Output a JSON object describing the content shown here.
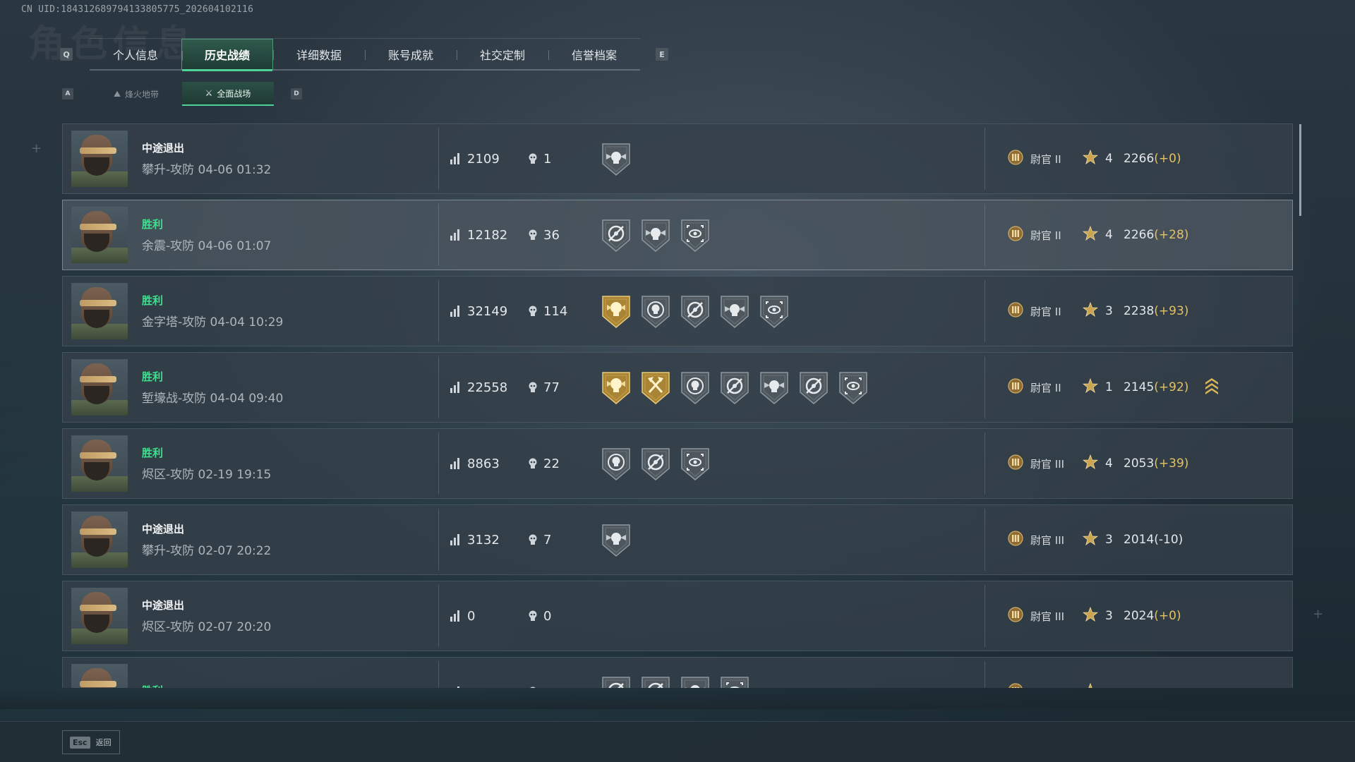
{
  "uid": "CN UID:18431268979413380577​5_202604102116",
  "tabs": {
    "left_key": "Q",
    "right_key": "E",
    "items": [
      {
        "label": "个人信息",
        "active": false
      },
      {
        "label": "历史战绩",
        "active": true
      },
      {
        "label": "详细数据",
        "active": false
      },
      {
        "label": "账号成就",
        "active": false
      },
      {
        "label": "社交定制",
        "active": false
      },
      {
        "label": "信誉档案",
        "active": false
      }
    ]
  },
  "subtabs": {
    "left_key": "A",
    "right_key": "D",
    "items": [
      {
        "label": "烽火地带",
        "icon": "flame-zone-icon",
        "active": false
      },
      {
        "label": "全面战场",
        "icon": "battlefield-icon",
        "active": true
      }
    ]
  },
  "matches": [
    {
      "result": "中途退出",
      "win": false,
      "meta": "攀升-攻防 04-06 01:32",
      "score": "2109",
      "kills": "1",
      "medals": [
        "skull-wings"
      ],
      "rank": "尉官 II",
      "stars": "4",
      "rating": "2266",
      "delta": "(+0)",
      "promo": false,
      "highlight": false
    },
    {
      "result": "胜利",
      "win": true,
      "meta": "余震-攻防 04-06 01:07",
      "score": "12182",
      "kills": "36",
      "medals": [
        "crosshair-gear",
        "skull-wings",
        "eye-target"
      ],
      "rank": "尉官 II",
      "stars": "4",
      "rating": "2266",
      "delta": "(+28)",
      "promo": false,
      "highlight": true
    },
    {
      "result": "胜利",
      "win": true,
      "meta": "金字塔-攻防 04-04 10:29",
      "score": "32149",
      "kills": "114",
      "medals": [
        "gold-skull",
        "skull-ring",
        "crosshair-gear",
        "skull-wings",
        "eye-target"
      ],
      "rank": "尉官 II",
      "stars": "3",
      "rating": "2238",
      "delta": "(+93)",
      "promo": false,
      "highlight": false
    },
    {
      "result": "胜利",
      "win": true,
      "meta": "堑壕战-攻防 04-04 09:40",
      "score": "22558",
      "kills": "77",
      "medals": [
        "gold-skull",
        "gold-axes",
        "skull-ring",
        "crosshair-gear",
        "skull-wings",
        "crosshair-gear",
        "eye-target"
      ],
      "rank": "尉官 II",
      "stars": "1",
      "rating": "2145",
      "delta": "(+92)",
      "promo": true,
      "highlight": false
    },
    {
      "result": "胜利",
      "win": true,
      "meta": "烬区-攻防 02-19 19:15",
      "score": "8863",
      "kills": "22",
      "medals": [
        "skull-ring",
        "crosshair-gear",
        "eye-target"
      ],
      "rank": "尉官 III",
      "stars": "4",
      "rating": "2053",
      "delta": "(+39)",
      "promo": false,
      "highlight": false
    },
    {
      "result": "中途退出",
      "win": false,
      "meta": "攀升-攻防 02-07 20:22",
      "score": "3132",
      "kills": "7",
      "medals": [
        "skull-wings"
      ],
      "rank": "尉官 III",
      "stars": "3",
      "rating": "2014",
      "delta": "(-10)",
      "promo": false,
      "highlight": false
    },
    {
      "result": "中途退出",
      "win": false,
      "meta": "烬区-攻防 02-07 20:20",
      "score": "0",
      "kills": "0",
      "medals": [],
      "rank": "尉官 III",
      "stars": "3",
      "rating": "2024",
      "delta": "(+0)",
      "promo": false,
      "highlight": false
    },
    {
      "result": "胜利",
      "win": true,
      "meta": "",
      "score": "",
      "kills": "",
      "medals": [
        "crosshair-gear",
        "crosshair-gear",
        "skull-wings",
        "eye-target"
      ],
      "rank": "",
      "stars": "",
      "rating": "",
      "delta": "",
      "promo": false,
      "highlight": false
    }
  ],
  "footer": {
    "esc_key": "Esc",
    "esc_label": "返回"
  },
  "colors": {
    "accent": "#4fd29a",
    "win": "#3fe08f",
    "delta": "#e3c263",
    "gold_medal": "#b08a3a",
    "grey_medal": "#5b646b"
  }
}
